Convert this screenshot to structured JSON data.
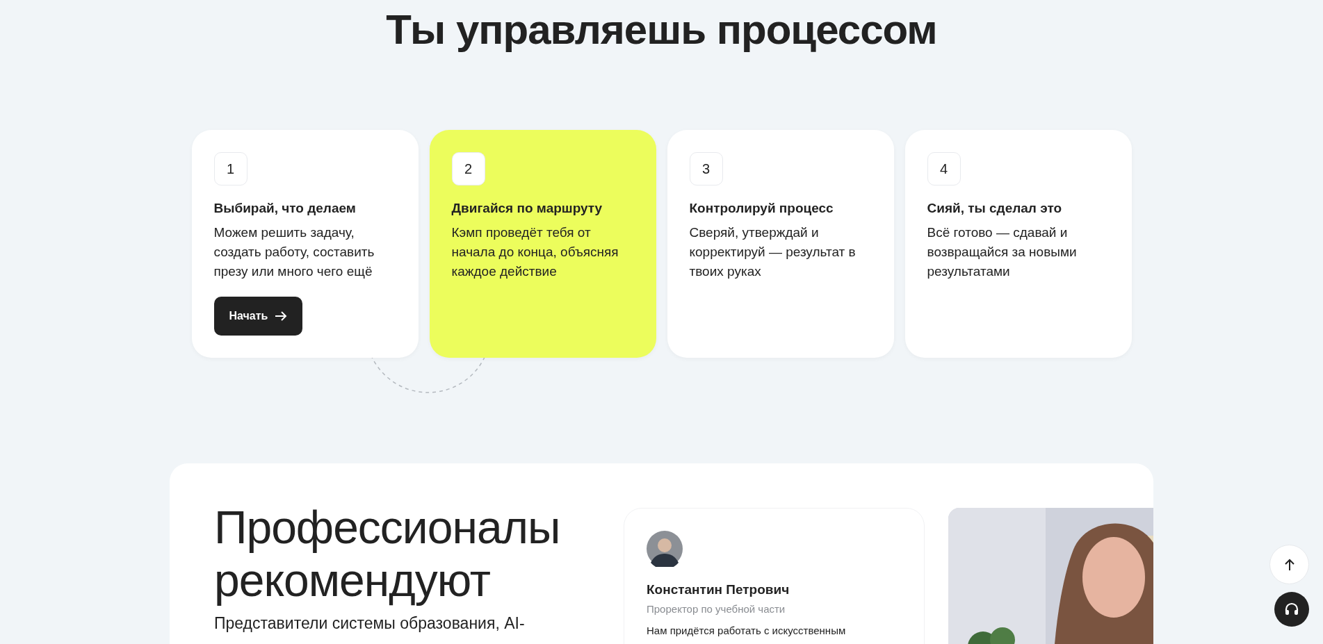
{
  "title": "Ты управляешь процессом",
  "steps": [
    {
      "number": "1",
      "title": "Выбирай, что делаем",
      "text": "Можем решить задачу, создать работу, составить презу или много чего ещё",
      "highlighted": false,
      "button": "Начать"
    },
    {
      "number": "2",
      "title": "Двигайся по маршруту",
      "text": "Кэмп проведёт тебя от начала до конца, объясняя каждое действие",
      "highlighted": true
    },
    {
      "number": "3",
      "title": "Контролируй процесс",
      "text": "Сверяй, утверждай и корректируй — результат в твоих руках",
      "highlighted": false
    },
    {
      "number": "4",
      "title": "Сияй, ты сделал это",
      "text": "Всё готово — сдавай и возвращайся за новыми результатами",
      "highlighted": false
    }
  ],
  "recommend": {
    "heading": "Профессионалы рекомендуют",
    "text": "Представители системы образования, AI-",
    "testimonial": {
      "name": "Константин Петрович",
      "role": "Проректор по учебной части",
      "quote": "Нам придётся работать с искусственным"
    }
  }
}
